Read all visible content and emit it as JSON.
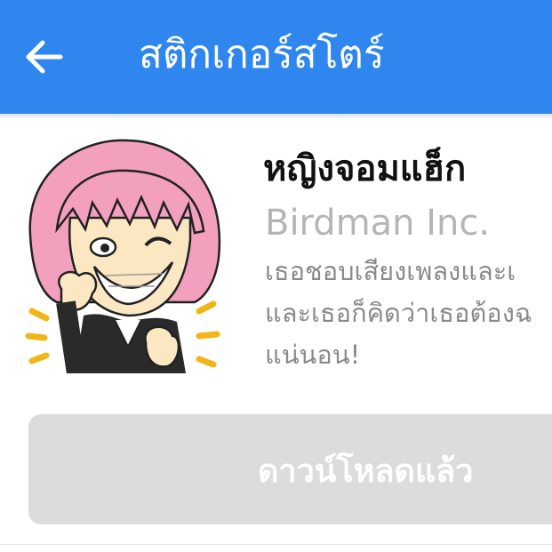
{
  "header": {
    "title": "สติกเกอร์สโตร์",
    "back_icon": "arrow-left-icon",
    "background_color": "#2f86ee"
  },
  "pack": {
    "title": "หญิงจอมแฮ็ก",
    "author": "Birdman Inc.",
    "description_lines": [
      "เธอชอบเสียงเพลงและเ",
      "และเธอก็คิดว่าเธอต้องฉ",
      "แน่นอน!"
    ],
    "sticker_icon": "pink-haired-girl-sticker"
  },
  "download_button": {
    "label": "ดาวน์โหลดแล้ว",
    "state": "disabled"
  }
}
